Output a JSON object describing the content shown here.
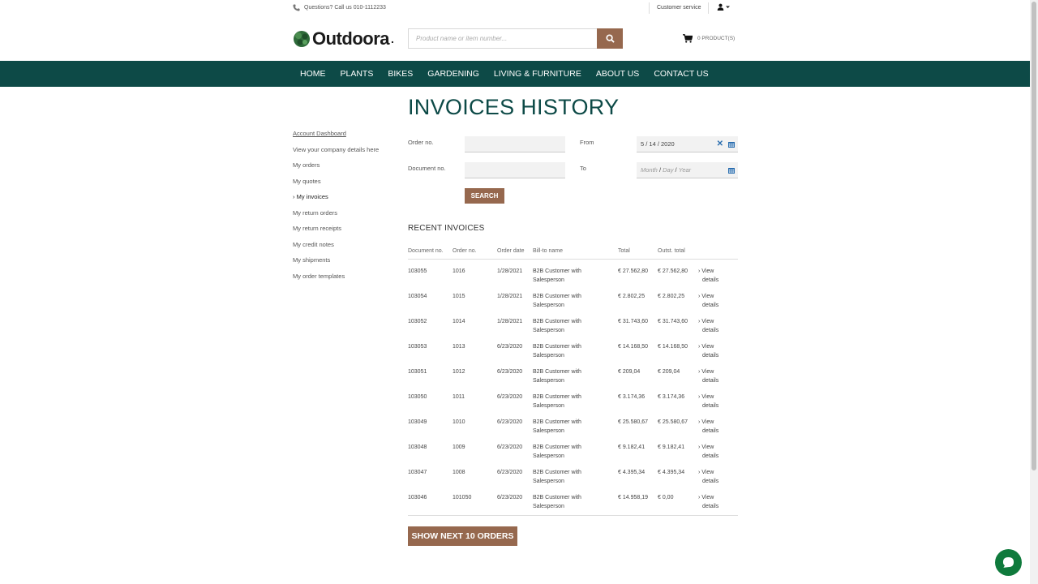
{
  "topbar": {
    "phone_text": "Questions? Call us 010-1112233",
    "customer_service": "Customer service"
  },
  "header": {
    "logo_text": "Outdoora",
    "search_placeholder": "Product name or item number...",
    "cart_text": "0 PRODUCT(S)"
  },
  "nav": [
    "HOME",
    "PLANTS",
    "BIKES",
    "GARDENING",
    "LIVING & FURNITURE",
    "ABOUT US",
    "CONTACT US"
  ],
  "sidebar": [
    "Account Dashboard",
    "View your company details here",
    "My orders",
    "My quotes",
    "› My invoices",
    "My return orders",
    "My return receipts",
    "My credit notes",
    "My shipments",
    "My order templates"
  ],
  "main": {
    "title": "INVOICES HISTORY",
    "order_no_label": "Order no.",
    "document_no_label": "Document no.",
    "from_label": "From",
    "to_label": "To",
    "from_value": "5 / 14 / 2020",
    "to_placeholder_month": "Month",
    "to_placeholder_day": "Day",
    "to_placeholder_year": "Year",
    "search_button": "SEARCH",
    "recent_title": "RECENT INVOICES",
    "next_button": "SHOW NEXT 10 ORDERS"
  },
  "table": {
    "headers": [
      "Document no.",
      "Order no.",
      "Order date",
      "Bill-to name",
      "Total",
      "Outst. total",
      ""
    ],
    "view_line1": "› View",
    "view_line2": "details",
    "rows": [
      {
        "doc": "103055",
        "order": "1016",
        "date": "1/28/2021",
        "bill1": "B2B Customer with",
        "bill2": "Salesperson",
        "total": "€ 27.562,80",
        "outst": "€ 27.562,80"
      },
      {
        "doc": "103054",
        "order": "1015",
        "date": "1/28/2021",
        "bill1": "B2B Customer with",
        "bill2": "Salesperson",
        "total": "€ 2.802,25",
        "outst": "€ 2.802,25"
      },
      {
        "doc": "103052",
        "order": "1014",
        "date": "1/28/2021",
        "bill1": "B2B Customer with",
        "bill2": "Salesperson",
        "total": "€ 31.743,60",
        "outst": "€ 31.743,60"
      },
      {
        "doc": "103053",
        "order": "1013",
        "date": "6/23/2020",
        "bill1": "B2B Customer with",
        "bill2": "Salesperson",
        "total": "€ 14.168,50",
        "outst": "€ 14.168,50"
      },
      {
        "doc": "103051",
        "order": "1012",
        "date": "6/23/2020",
        "bill1": "B2B Customer with",
        "bill2": "Salesperson",
        "total": "€ 209,04",
        "outst": "€ 209,04"
      },
      {
        "doc": "103050",
        "order": "1011",
        "date": "6/23/2020",
        "bill1": "B2B Customer with",
        "bill2": "Salesperson",
        "total": "€ 3.174,36",
        "outst": "€ 3.174,36"
      },
      {
        "doc": "103049",
        "order": "1010",
        "date": "6/23/2020",
        "bill1": "B2B Customer with",
        "bill2": "Salesperson",
        "total": "€ 25.580,67",
        "outst": "€ 25.580,67"
      },
      {
        "doc": "103048",
        "order": "1009",
        "date": "6/23/2020",
        "bill1": "B2B Customer with",
        "bill2": "Salesperson",
        "total": "€ 9.182,41",
        "outst": "€ 9.182,41"
      },
      {
        "doc": "103047",
        "order": "1008",
        "date": "6/23/2020",
        "bill1": "B2B Customer with",
        "bill2": "Salesperson",
        "total": "€ 4.395,34",
        "outst": "€ 4.395,34"
      },
      {
        "doc": "103046",
        "order": "101050",
        "date": "6/23/2020",
        "bill1": "B2B Customer with",
        "bill2": "Salesperson",
        "total": "€ 14.958,19",
        "outst": "€ 0,00"
      }
    ]
  },
  "colors": {
    "nav_bg": "#0d4a47",
    "accent_brown": "#96684e",
    "chat_green": "#0f7a3c"
  },
  "icons": [
    "phone-icon",
    "user-icon",
    "search-icon",
    "cart-icon",
    "calendar-icon",
    "clear-icon",
    "chat-icon"
  ]
}
